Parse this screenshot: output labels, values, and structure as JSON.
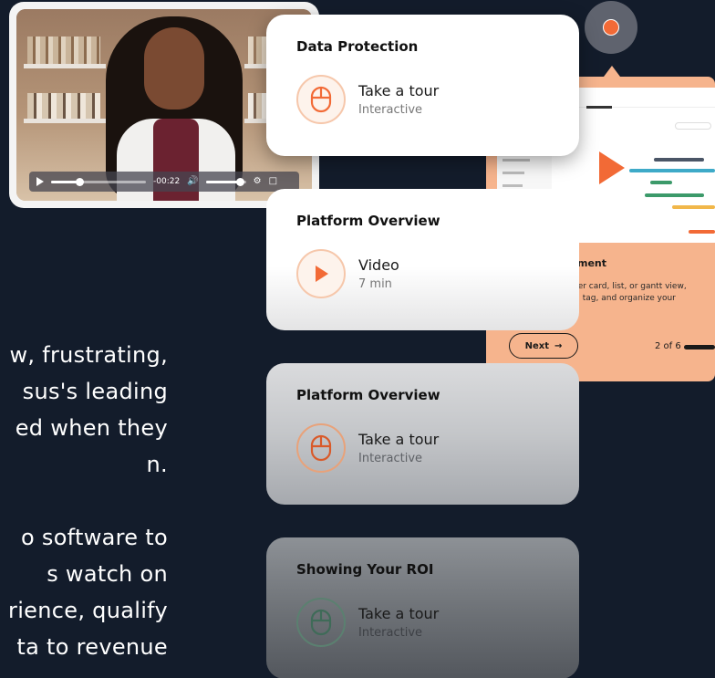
{
  "video": {
    "time": "-00:22",
    "progress": 0.3,
    "volume": 0.85
  },
  "paragraph1": [
    "w, frustrating,",
    "sus's  leading",
    "ed when they",
    "n."
  ],
  "paragraph2": [
    "o software to",
    "s  watch   on",
    "rience, qualify",
    "ta to revenue"
  ],
  "app_preview": {
    "heading": "ment",
    "description": [
      "efer card, list, or gantt view,",
      "el, tag, and organize your"
    ],
    "next_label": "Next",
    "next_arrow": "→",
    "step_text": "2 of 6"
  },
  "cards": [
    {
      "title": "Data Protection",
      "main": "Take a tour",
      "sub": "Interactive",
      "icon": "mouse-icon"
    },
    {
      "title": "Platform Overview",
      "main": "Video",
      "sub": "7 min",
      "icon": "play-icon"
    },
    {
      "title": "Platform Overview",
      "main": "Take a tour",
      "sub": "Interactive",
      "icon": "mouse-icon"
    },
    {
      "title": "Showing Your ROI",
      "main": "Take a tour",
      "sub": "Interactive",
      "icon": "mouse-icon"
    }
  ],
  "colors": {
    "background": "#131c2b",
    "accent": "#f26a36",
    "peach": "#f6b48d"
  }
}
